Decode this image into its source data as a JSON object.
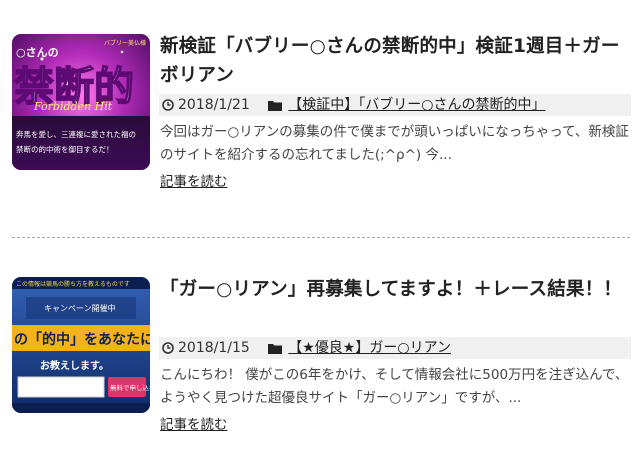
{
  "posts": [
    {
      "title": "新検証「バブリー○さんの禁断的中」検証1週目＋ガーボリアン",
      "date": "2018/1/21",
      "category": "【検証中】「バブリー○さんの禁断的中」",
      "excerpt": "今回はガー○リアンの募集の件で僕までが頭いっぱいになっちゃって、新検証のサイトを紹介するの忘れてました(;^ρ^) 今...",
      "read_more": "記事を読む",
      "thumb": {
        "small_text": "バブリー美仏様",
        "heading_text": "○さんの",
        "big_text": "禁断的",
        "sub_text": "Forbidden Hit",
        "caption1": "奔馬を愛し、三連複に愛された福の",
        "caption2": "禁断の的中術を御目するだ！",
        "colors": {
          "bg": "#7a1a8e",
          "accent": "#e23fd0"
        }
      }
    },
    {
      "title": "「ガー○リアン」再募集してますよ！＋レース結果！！",
      "date": "2018/1/15",
      "category": "【★優良★】ガー○リアン",
      "excerpt": "こんにちわ！ 僕がこの6年をかけ、そして情報会社に500万円を注ぎ込んで、 ようやく見つけた超優良サイト「ガー○リアン」ですが、...",
      "read_more": "記事を読む",
      "thumb": {
        "top_text": "この情報は競馬の勝ち方を教えるものです",
        "mid_text": "キャンペーン開催中",
        "banner_text": "の「的中」をあなたに",
        "sub_text": "お教えします。",
        "button_text": "無料で申し込む",
        "colors": {
          "bg": "#1c3f8a",
          "accent": "#f4b21b"
        }
      }
    }
  ]
}
